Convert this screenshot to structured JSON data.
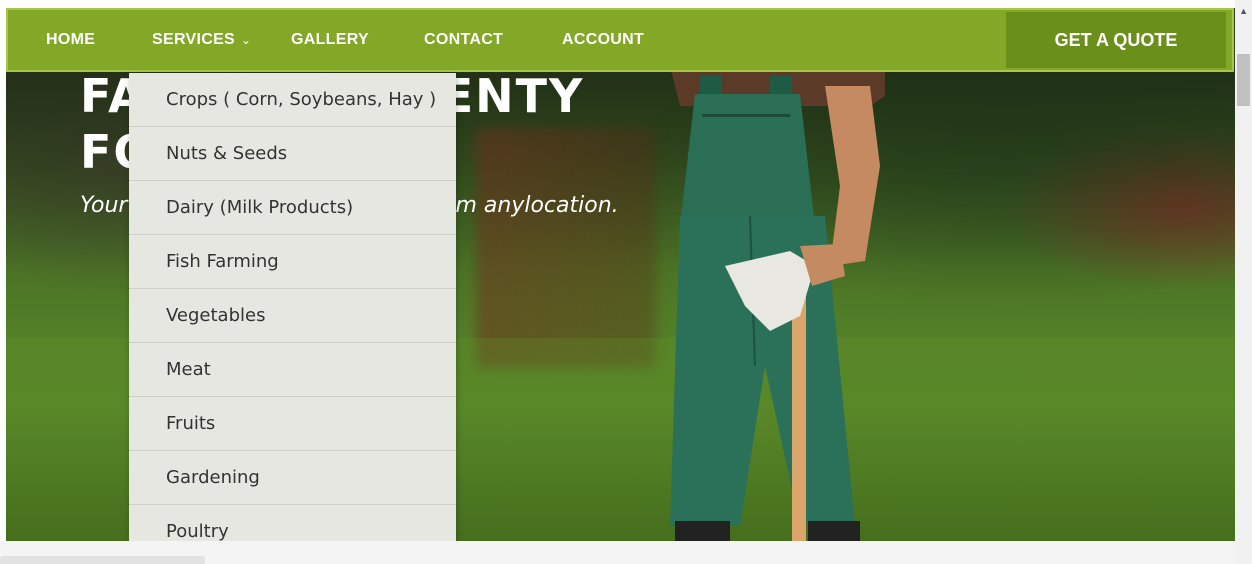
{
  "nav": {
    "items": [
      {
        "label": "HOME"
      },
      {
        "label": "SERVICES",
        "chevron": "chevron-down-icon"
      },
      {
        "label": "GALLERY"
      },
      {
        "label": "CONTACT"
      },
      {
        "label": "ACCOUNT"
      }
    ],
    "quote_button": "GET A QUOTE",
    "colors": {
      "bar": "#83a726",
      "quote_bg": "#6a8f1a"
    }
  },
  "hero": {
    "title_line1": "FA",
    "title_line1_tail": "ENTY",
    "title_line2": "FO",
    "subtitle_start": "Your",
    "subtitle_tail": "m anylocation."
  },
  "services_menu": {
    "items": [
      "Crops ( Corn, Soybeans, Hay )",
      "Nuts & Seeds",
      "Dairy (Milk Products)",
      "Fish Farming",
      "Vegetables",
      "Meat",
      "Fruits",
      "Gardening",
      "Poultry"
    ]
  }
}
